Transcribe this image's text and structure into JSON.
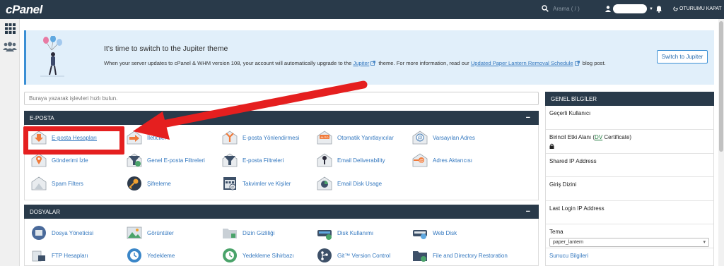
{
  "topbar": {
    "logo": "cPanel",
    "search_placeholder": "Arama ( / )",
    "logout": "OTURUMU KAPAT"
  },
  "banner": {
    "title": "It's time to switch to the Jupiter theme",
    "text_before": "When your server updates to cPanel & WHM version 108, your account will automatically upgrade to the",
    "link1": "Jupiter",
    "text_middle": "theme. For more information, read our",
    "link2": "Updated Paper Lantern Removal Schedule",
    "text_after": "blog post.",
    "button": "Switch to Jupiter"
  },
  "quick_search": {
    "placeholder": "Buraya yazarak işlevleri hızlı bulun."
  },
  "email_section": {
    "title": "E-POSTA",
    "items": [
      {
        "label": "E-posta Hesapları",
        "icon": "email-accounts-icon"
      },
      {
        "label": "İleticiler",
        "icon": "forwarders-icon"
      },
      {
        "label": "E-posta Yönlendirmesi",
        "icon": "email-routing-icon"
      },
      {
        "label": "Otomatik Yanıtlayıcılar",
        "icon": "autoresponders-icon"
      },
      {
        "label": "Varsayılan Adres",
        "icon": "default-address-icon"
      },
      {
        "label": "Gönderimi İzle",
        "icon": "track-delivery-icon"
      },
      {
        "label": "Genel E-posta Filtreleri",
        "icon": "global-filters-icon"
      },
      {
        "label": "E-posta Filtreleri",
        "icon": "email-filters-icon"
      },
      {
        "label": "Email Deliverability",
        "icon": "email-deliverability-icon"
      },
      {
        "label": "Adres Aktarıcısı",
        "icon": "address-importer-icon"
      },
      {
        "label": "Spam Filters",
        "icon": "spam-filters-icon"
      },
      {
        "label": "Şifreleme",
        "icon": "encryption-icon"
      },
      {
        "label": "Takvimler ve Kişiler",
        "icon": "calendars-contacts-icon"
      },
      {
        "label": "Email Disk Usage",
        "icon": "email-disk-usage-icon"
      }
    ]
  },
  "files_section": {
    "title": "DOSYALAR",
    "items": [
      {
        "label": "Dosya Yöneticisi",
        "icon": "file-manager-icon"
      },
      {
        "label": "Görüntüler",
        "icon": "images-icon"
      },
      {
        "label": "Dizin Gizliliği",
        "icon": "directory-privacy-icon"
      },
      {
        "label": "Disk Kullanımı",
        "icon": "disk-usage-icon"
      },
      {
        "label": "Web Disk",
        "icon": "web-disk-icon"
      },
      {
        "label": "FTP Hesapları",
        "icon": "ftp-accounts-icon"
      },
      {
        "label": "Yedekleme",
        "icon": "backup-icon"
      },
      {
        "label": "Yedekleme Sihirbazı",
        "icon": "backup-wizard-icon"
      },
      {
        "label": "Git™ Version Control",
        "icon": "git-icon"
      },
      {
        "label": "File and Directory Restoration",
        "icon": "file-restoration-icon"
      }
    ]
  },
  "general_info": {
    "title": "GENEL BİLGİLER",
    "current_user": "Geçerli Kullanıcı",
    "primary_domain": "Birincil Etki Alanı",
    "primary_domain_open": "(",
    "dv": "DV",
    "primary_domain_cert": " Certificate)",
    "shared_ip": "Shared IP Address",
    "home_dir": "Giriş Dizini",
    "last_login": "Last Login IP Address",
    "theme_label": "Tema",
    "theme_value": "paper_lantern",
    "server_info": "Sunucu Bilgileri"
  },
  "colors": {
    "navbar": "#293a4a",
    "banner_bg": "#e1effa",
    "link": "#3478bf",
    "highlight": "#e51f1f"
  }
}
